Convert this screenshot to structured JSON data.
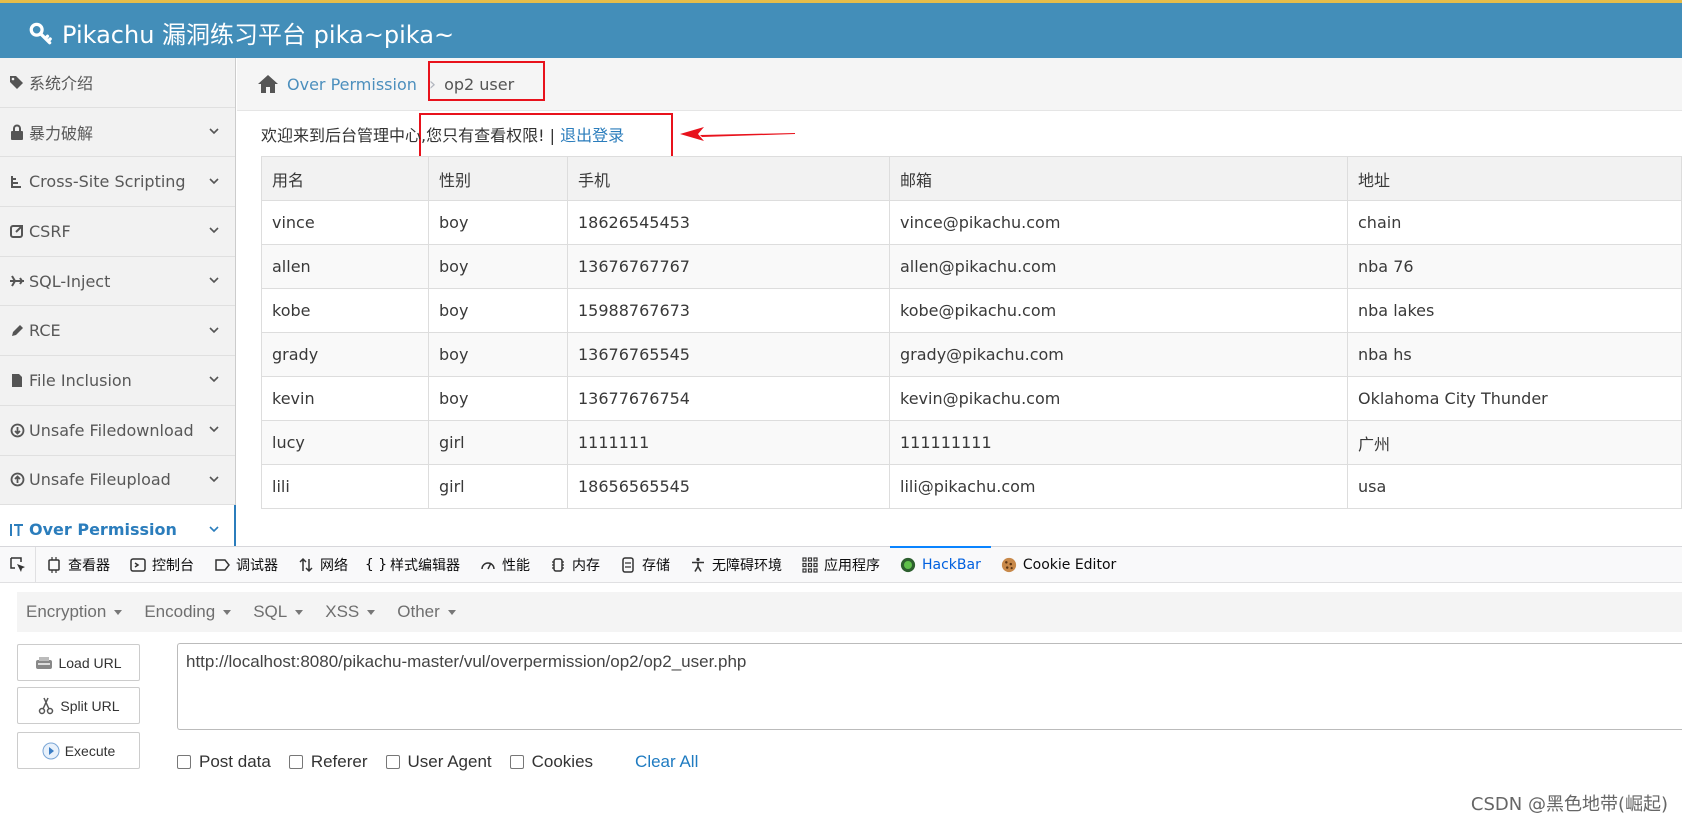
{
  "header": {
    "title": "Pikachu 漏洞练习平台 pika~pika~",
    "logo_icon": "key-icon"
  },
  "sidebar": {
    "items": [
      {
        "label": "系统介绍",
        "icon": "tags-icon",
        "expandable": false,
        "active": false
      },
      {
        "label": "暴力破解",
        "icon": "lock-icon",
        "expandable": true,
        "active": false
      },
      {
        "label": "Cross-Site Scripting",
        "icon": "tree-icon",
        "expandable": true,
        "active": false
      },
      {
        "label": "CSRF",
        "icon": "share-icon",
        "expandable": true,
        "active": false
      },
      {
        "label": "SQL-Inject",
        "icon": "plane-icon",
        "expandable": true,
        "active": false
      },
      {
        "label": "RCE",
        "icon": "pencil-icon",
        "expandable": true,
        "active": false
      },
      {
        "label": "File Inclusion",
        "icon": "file-icon",
        "expandable": true,
        "active": false
      },
      {
        "label": "Unsafe Filedownload",
        "icon": "download-icon",
        "expandable": true,
        "active": false
      },
      {
        "label": "Unsafe Fileupload",
        "icon": "upload-icon",
        "expandable": true,
        "active": false
      },
      {
        "label": "Over Permission",
        "icon": "text-height-icon",
        "expandable": true,
        "active": true
      }
    ]
  },
  "breadcrumb": {
    "parent": "Over Permission",
    "current": "op2 user"
  },
  "welcome": {
    "text": "欢迎来到后台管理中心,您只有查看权限! | ",
    "logout": "退出登录"
  },
  "table": {
    "headers": [
      "用名",
      "性别",
      "手机",
      "邮箱",
      "地址"
    ],
    "rows": [
      [
        "vince",
        "boy",
        "18626545453",
        "vince@pikachu.com",
        "chain"
      ],
      [
        "allen",
        "boy",
        "13676767767",
        "allen@pikachu.com",
        "nba 76"
      ],
      [
        "kobe",
        "boy",
        "15988767673",
        "kobe@pikachu.com",
        "nba lakes"
      ],
      [
        "grady",
        "boy",
        "13676765545",
        "grady@pikachu.com",
        "nba hs"
      ],
      [
        "kevin",
        "boy",
        "13677676754",
        "kevin@pikachu.com",
        "Oklahoma City Thunder"
      ],
      [
        "lucy",
        "girl",
        "1111111",
        "111111111",
        "广州"
      ],
      [
        "lili",
        "girl",
        "18656565545",
        "lili@pikachu.com",
        "usa"
      ]
    ]
  },
  "devtools": {
    "tabs": [
      {
        "label": "查看器",
        "icon": "inspector-icon",
        "active": false
      },
      {
        "label": "控制台",
        "icon": "console-icon",
        "active": false
      },
      {
        "label": "调试器",
        "icon": "debugger-icon",
        "active": false
      },
      {
        "label": "网络",
        "icon": "network-icon",
        "active": false
      },
      {
        "label": "样式编辑器",
        "icon": "style-editor-icon",
        "active": false
      },
      {
        "label": "性能",
        "icon": "performance-icon",
        "active": false
      },
      {
        "label": "内存",
        "icon": "memory-icon",
        "active": false
      },
      {
        "label": "存储",
        "icon": "storage-icon",
        "active": false
      },
      {
        "label": "无障碍环境",
        "icon": "accessibility-icon",
        "active": false
      },
      {
        "label": "应用程序",
        "icon": "application-icon",
        "active": false
      },
      {
        "label": "HackBar",
        "icon": "hackbar-icon",
        "active": true
      },
      {
        "label": "Cookie Editor",
        "icon": "cookie-icon",
        "active": false
      }
    ]
  },
  "hackbar": {
    "menus": [
      "Encryption",
      "Encoding",
      "SQL",
      "XSS",
      "Other"
    ],
    "load_url": "Load URL",
    "split_url": "Split URL",
    "execute": "Execute",
    "url": "http://localhost:8080/pikachu-master/vul/overpermission/op2/op2_user.php",
    "options": [
      "Post data",
      "Referer",
      "User Agent",
      "Cookies"
    ],
    "clear_all": "Clear All"
  },
  "watermark": "CSDN @黑色地带(崛起)",
  "colors": {
    "header_bg": "#438eb9",
    "annotation_red": "#e8121c",
    "link_blue": "#2b7dbc"
  }
}
